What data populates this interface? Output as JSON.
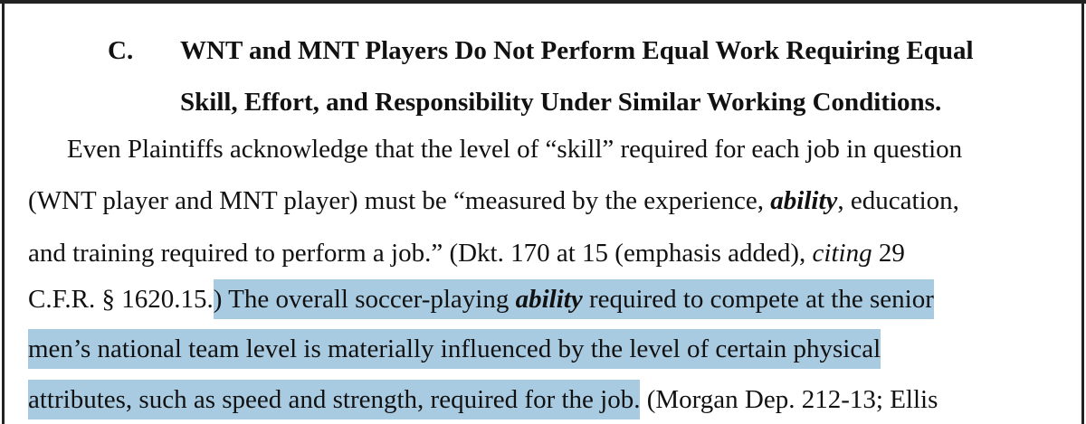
{
  "heading": {
    "letter": "C.",
    "line1": "WNT and MNT Players Do Not Perform Equal Work Requiring Equal",
    "line2": "Skill, Effort, and Responsibility Under Similar Working Conditions."
  },
  "body": {
    "line1": "Even Plaintiffs acknowledge that the level of “skill” required for each job in question",
    "line2_a": "(WNT player and MNT player) must be “measured by the experience, ",
    "line2_b": "ability",
    "line2_c": ", education,",
    "line3_a": "and training required to perform a job.” (Dkt. 170 at 15 (emphasis added), ",
    "line3_b": "citing",
    "line3_c": " 29",
    "line4_a": "C.F.R. § 1620.15.",
    "line4_b": ") The overall soccer-playing ",
    "line4_c": "ability",
    "line4_d": " required to compete at the senior",
    "line5": "men’s national team level is materially influenced by the level of certain physical",
    "line6_a": "attributes, such as speed and strength, required for the job.",
    "line6_b": " (Morgan Dep. 212-13; Ellis"
  },
  "highlight_color": "#a9cbe2"
}
